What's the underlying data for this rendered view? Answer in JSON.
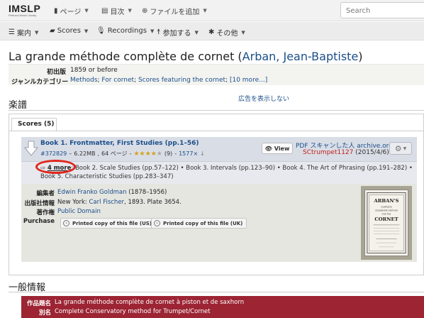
{
  "logo": {
    "name": "IMSLP",
    "tagline": "Petrucci Music Library"
  },
  "topbar": {
    "items": [
      {
        "label": "ページ"
      },
      {
        "label": "目次"
      },
      {
        "label": "ファイルを追加"
      }
    ],
    "search_placeholder": "Search"
  },
  "nav": {
    "items": [
      {
        "label": "案内"
      },
      {
        "label": "Scores"
      },
      {
        "label": "Recordings"
      },
      {
        "label": "参加する"
      },
      {
        "label": "その他"
      }
    ]
  },
  "work": {
    "title_prefix": "La grande méthode complète de cornet (",
    "composer": "Arban, Jean-Baptiste",
    "title_suffix": ")"
  },
  "meta": {
    "first_pub_label": "初出版",
    "first_pub_value": "1859 or before",
    "genre_label": "ジャンルカテゴリー",
    "genre_links": [
      "Methods",
      "For cornet",
      "Scores featuring the cornet"
    ],
    "genre_more": "[10 more...]"
  },
  "scores_section": {
    "heading": "楽譜",
    "ad_text": "広告を表示しない",
    "tab_label": "Scores (5)"
  },
  "score": {
    "title": "Book 1. Frontmatter, First Studies (pp.1–56)",
    "file_id": "#372829",
    "size": "6.22MB",
    "pages": "64 ページ",
    "rating": 4.0,
    "rating_count": "(9)",
    "downloads": "1577×",
    "view_label": "View",
    "pdf_label": "PDF スキャンした人",
    "source": "archive.org",
    "scanner": "SCtrumpet1127",
    "date": "(2015/4/6)"
  },
  "more": {
    "link": "4 more",
    "items_line1": "Book 2. Scale Studies (pp.57–122) • Book 3. Intervals (pp.123–90) • Book 4. The Art of Phrasing (pp.191–282) •",
    "items_line2": "Book 5. Characteristic Studies (pp.283–347)"
  },
  "info": {
    "editor_label": "編集者",
    "editor_value": "Edwin Franko Goldman",
    "editor_years": "(1878–1956)",
    "publisher_label": "出版社情報",
    "publisher_city": "New York: ",
    "publisher_name": "Carl Fischer",
    "publisher_rest": ", 1893. Plate 3654.",
    "copyright_label": "著作権",
    "copyright_value": "Public Domain",
    "purchase_label": "Purchase",
    "purchase_us": "Printed copy of this file (US)",
    "purchase_uk": "Printed copy of this file (UK)"
  },
  "cover": {
    "line1": "ARBAN'S",
    "line2": "COMPLETE",
    "line3": "CELEBRATED METHOD",
    "line4": "FOR THE",
    "line5": "CORNET"
  },
  "general": {
    "heading": "一般情報",
    "work_title_label": "作品題名",
    "work_title_value": "La grande méthode complète de cornet à piston et de saxhorn",
    "alt_label": "別名",
    "alt_value": "Complete Conservatory method for Trumpet/Cornet"
  },
  "colors": {
    "link": "#1a4f8a",
    "accent_red": "#c0221c",
    "general_bg": "#9c2433"
  }
}
